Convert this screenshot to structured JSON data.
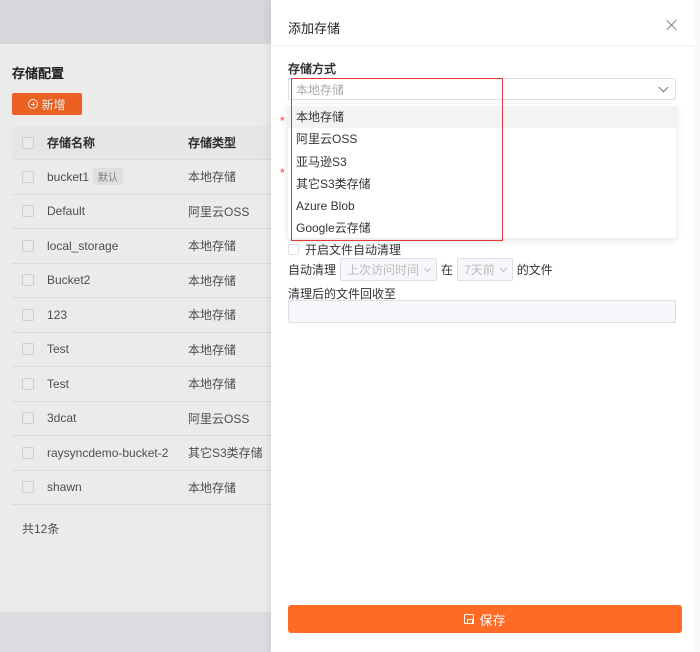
{
  "background": {
    "title": "存储配置",
    "add_button": "新增",
    "columns": {
      "name": "存储名称",
      "type": "存储类型"
    },
    "default_tag": "默认",
    "rows": [
      {
        "name": "bucket1",
        "type": "本地存储",
        "is_default": true
      },
      {
        "name": "Default",
        "type": "阿里云OSS"
      },
      {
        "name": "local_storage",
        "type": "本地存储"
      },
      {
        "name": "Bucket2",
        "type": "本地存储"
      },
      {
        "name": "123",
        "type": "本地存储"
      },
      {
        "name": "Test",
        "type": "本地存储"
      },
      {
        "name": "Test",
        "type": "本地存储"
      },
      {
        "name": "3dcat",
        "type": "阿里云OSS"
      },
      {
        "name": "raysyncdemo-bucket-2",
        "type": "其它S3类存储"
      },
      {
        "name": "shawn",
        "type": "本地存储"
      }
    ],
    "total": "共12条"
  },
  "drawer": {
    "title": "添加存储",
    "storage_method_label": "存储方式",
    "select_placeholder": "本地存储",
    "options": [
      "本地存储",
      "阿里云OSS",
      "亚马逊S3",
      "其它S3类存储",
      "Azure Blob",
      "Google云存储"
    ],
    "active_option_index": 0,
    "required_mark": "*",
    "auto_clean_toggle": "开启文件自动清理",
    "auto_clean": {
      "prefix": "自动清理",
      "basis": "上次访问时间",
      "in": "在",
      "period": "7天前",
      "suffix": "的文件"
    },
    "recycle_label": "清理后的文件回收至",
    "save_button": "保存"
  },
  "colors": {
    "accent": "#ff6a24",
    "highlight": "#e53935"
  }
}
